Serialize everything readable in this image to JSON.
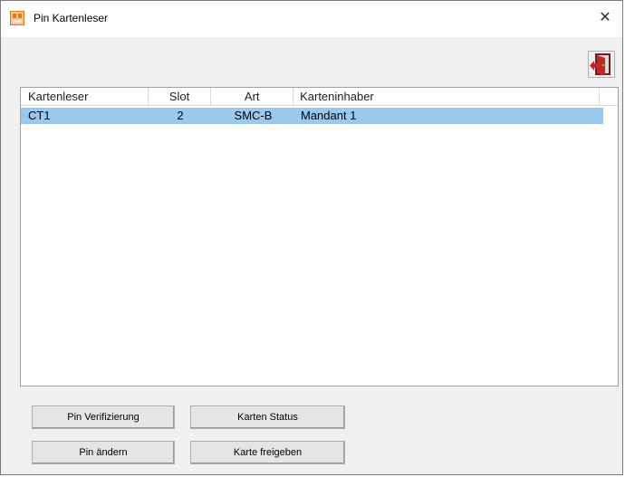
{
  "window": {
    "title": "Pin Kartenleser",
    "close_glyph": "✕"
  },
  "toolbar": {
    "exit_icon": "exit-door-icon"
  },
  "table": {
    "columns": [
      "Kartenleser",
      "Slot",
      "Art",
      "Karteninhaber"
    ],
    "rows": [
      {
        "Kartenleser": "CT1",
        "Slot": "2",
        "Art": "SMC-B",
        "Karteninhaber": "Mandant 1"
      }
    ],
    "selected_row_color": "#99c9ef"
  },
  "buttons": {
    "pin_verify": "Pin Verifizierung",
    "card_status": "Karten Status",
    "pin_change": "Pin ändern",
    "card_release": "Karte freigeben"
  }
}
